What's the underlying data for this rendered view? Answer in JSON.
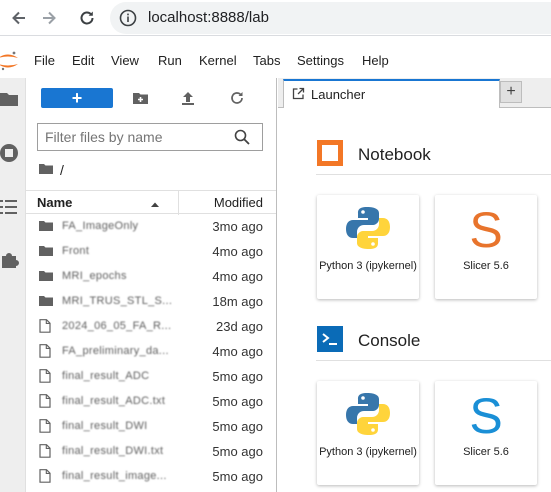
{
  "browser": {
    "url": "localhost:8888/lab",
    "nav_icons": [
      "back-arrow-icon",
      "forward-arrow-icon",
      "reload-icon"
    ]
  },
  "menu": {
    "items": [
      "File",
      "Edit",
      "View",
      "Run",
      "Kernel",
      "Tabs",
      "Settings",
      "Help"
    ]
  },
  "activity_bar": {
    "icons": [
      "folder-icon",
      "running-icon",
      "toc-icon",
      "extension-icon"
    ]
  },
  "file_browser": {
    "toolbar": {
      "new_label": "+",
      "icons": [
        "new-folder-icon",
        "upload-icon",
        "refresh-icon"
      ]
    },
    "filter_placeholder": "Filter files by name",
    "breadcrumb": "/",
    "headers": {
      "name": "Name",
      "modified": "Modified"
    },
    "files": [
      {
        "type": "folder",
        "name": "FA_ImageOnly",
        "modified": "3mo ago"
      },
      {
        "type": "folder",
        "name": "Front",
        "modified": "4mo ago"
      },
      {
        "type": "folder",
        "name": "MRI_epochs",
        "modified": "4mo ago"
      },
      {
        "type": "folder",
        "name": "MRI_TRUS_STL_S...",
        "modified": "18m ago"
      },
      {
        "type": "file",
        "name": "2024_06_05_FA_R...",
        "modified": "23d ago"
      },
      {
        "type": "file",
        "name": "FA_preliminary_da...",
        "modified": "4mo ago"
      },
      {
        "type": "file",
        "name": "final_result_ADC",
        "modified": "5mo ago"
      },
      {
        "type": "file",
        "name": "final_result_ADC.txt",
        "modified": "5mo ago"
      },
      {
        "type": "file",
        "name": "final_result_DWI",
        "modified": "5mo ago"
      },
      {
        "type": "file",
        "name": "final_result_DWI.txt",
        "modified": "5mo ago"
      },
      {
        "type": "file",
        "name": "final_result_image...",
        "modified": "5mo ago"
      }
    ]
  },
  "launcher": {
    "tab_label": "Launcher",
    "add_tab_label": "+",
    "sections": [
      {
        "title": "Notebook",
        "cards": [
          {
            "label": "Python 3 (ipykernel)",
            "icon": "python-logo-icon"
          },
          {
            "label": "Slicer 5.6",
            "icon": "slicer-logo-icon",
            "color": "#e8742c"
          }
        ]
      },
      {
        "title": "Console",
        "cards": [
          {
            "label": "Python 3 (ipykernel)",
            "icon": "python-logo-icon"
          },
          {
            "label": "Slicer 5.6",
            "icon": "slicer-logo-icon",
            "color": "#1a8fd6"
          }
        ]
      }
    ]
  },
  "colors": {
    "accent": "#1976d2",
    "notebook_icon": "#f37726",
    "console_icon": "#0a6bb7"
  }
}
